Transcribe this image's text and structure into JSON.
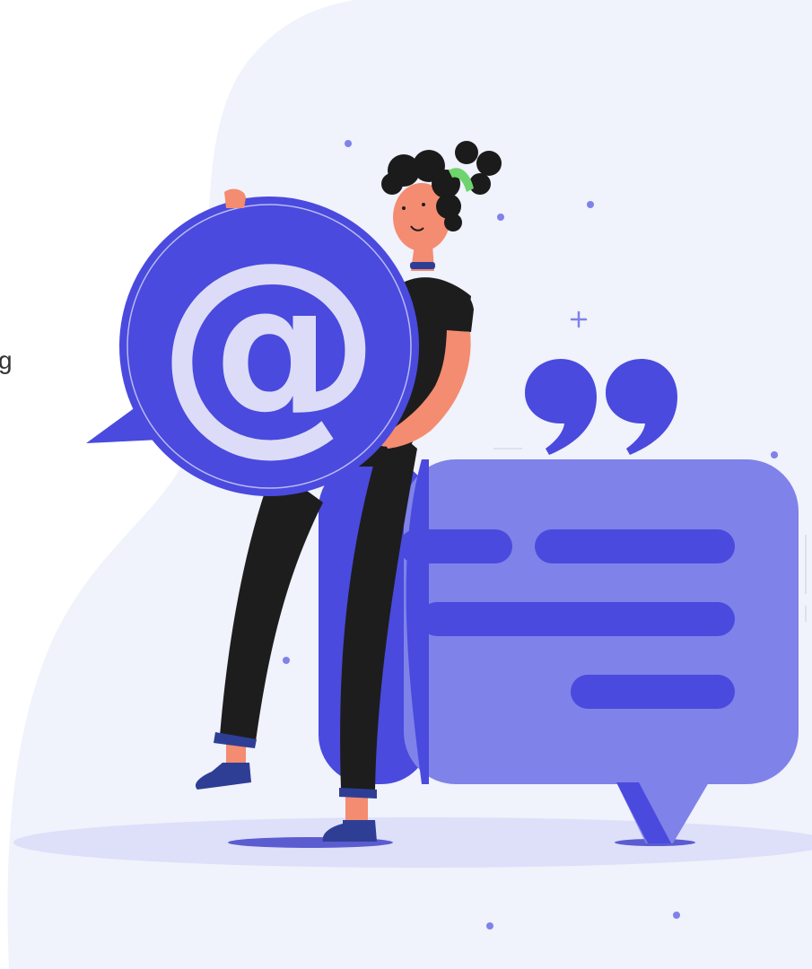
{
  "edge_text": "g",
  "bubble_symbol": "@",
  "colors": {
    "background_blob": "#f0f2fc",
    "indigo": "#4a4ade",
    "periwinkle": "#7f82e8",
    "lavender": "#dcdcf8",
    "skin": "#f48c71",
    "hair": "#1b1b1b",
    "clothing": "#1d1d1d",
    "hair_tie": "#6ed46d",
    "shoes": "#2f3e95",
    "floor_shadow": "#dedff9"
  },
  "icons": [
    "at-sign-speech-bubble",
    "chat-bubble-with-text-lines",
    "quotation-marks",
    "sparkle",
    "dot"
  ]
}
